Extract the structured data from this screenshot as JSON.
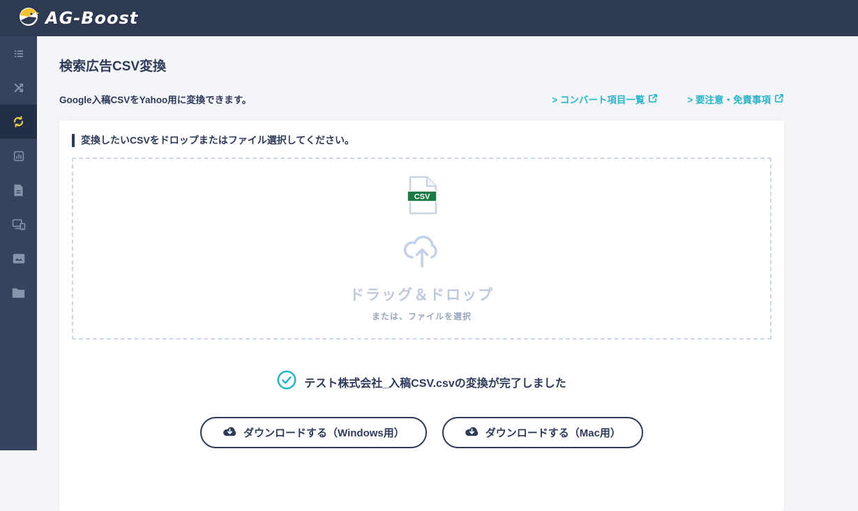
{
  "header": {
    "logo_text": "AG-Boost"
  },
  "sidebar": {
    "items": [
      {
        "icon": "list-icon",
        "active": false
      },
      {
        "icon": "shuffle-icon",
        "active": false
      },
      {
        "icon": "convert-sync-icon",
        "active": true
      },
      {
        "icon": "bar-chart-icon",
        "active": false
      },
      {
        "icon": "document-icon",
        "active": false
      },
      {
        "icon": "devices-icon",
        "active": false
      },
      {
        "icon": "image-icon",
        "active": false
      },
      {
        "icon": "folder-icon",
        "active": false
      }
    ]
  },
  "page": {
    "title": "検索広告CSV変換",
    "subtitle": "Google入稿CSVをYahoo用に変換できます。",
    "links": [
      {
        "label": "> コンバート項目一覧"
      },
      {
        "label": "> 要注意・免責事項"
      }
    ]
  },
  "card": {
    "instruction": "変換したいCSVをドロップまたはファイル選択してください。",
    "dropzone": {
      "file_badge": "CSV",
      "main_text": "ドラッグ＆ドロップ",
      "sub_text": "または、ファイルを選択"
    },
    "result": {
      "message": "テスト株式会社_入稿CSV.csvの変換が完了しました"
    },
    "buttons": [
      {
        "label": "ダウンロードする（Windows用）"
      },
      {
        "label": "ダウンロードする（Mac用）"
      }
    ]
  },
  "colors": {
    "header_navy": "#2e3a52",
    "sidebar_navy": "#36425e",
    "text_navy": "#2e3a59",
    "accent_teal": "#2ab4c8",
    "active_yellow": "#e8cc4d",
    "csv_green": "#1d7a44",
    "dropzone_border": "#ccd7e7"
  }
}
